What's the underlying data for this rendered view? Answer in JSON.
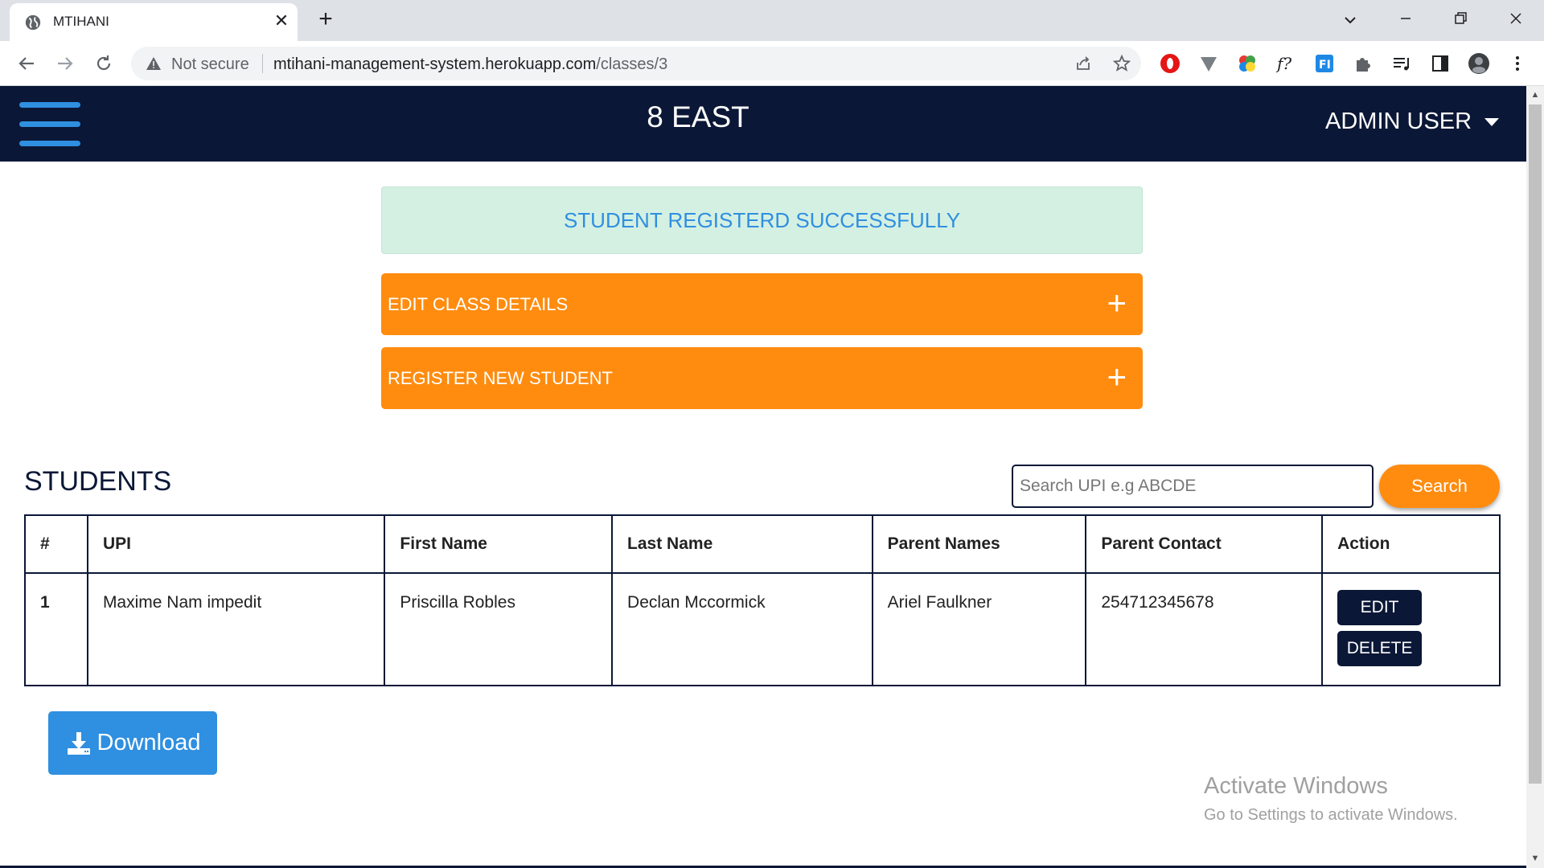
{
  "browser": {
    "tab_title": "MTIHANI",
    "security_label": "Not secure",
    "url_host": "mtihani-management-system.herokuapp.com",
    "url_path": "/classes/3",
    "new_tab_symbol": "+",
    "tab_close_symbol": "✕"
  },
  "header": {
    "title": "8 EAST",
    "user_label": "ADMIN USER"
  },
  "alert": {
    "message": "STUDENT REGISTERD SUCCESSFULLY"
  },
  "accordions": [
    {
      "label": "EDIT CLASS DETAILS",
      "icon": "+"
    },
    {
      "label": "REGISTER NEW STUDENT",
      "icon": "+"
    }
  ],
  "students": {
    "section_title": "STUDENTS",
    "search_placeholder": "Search UPI e.g ABCDE",
    "search_button": "Search",
    "columns": [
      "#",
      "UPI",
      "First Name",
      "Last Name",
      "Parent Names",
      "Parent Contact",
      "Action"
    ],
    "rows": [
      {
        "num": "1",
        "upi": "Maxime Nam impedit",
        "first_name": "Priscilla Robles",
        "last_name": "Declan Mccormick",
        "parent_names": "Ariel Faulkner",
        "parent_contact": "254712345678",
        "edit_label": "EDIT",
        "delete_label": "DELETE"
      }
    ]
  },
  "download": {
    "label": "Download"
  },
  "watermark": {
    "line1": "Activate Windows",
    "line2": "Go to Settings to activate Windows."
  },
  "colors": {
    "navy": "#0b1736",
    "orange": "#ff8c0f",
    "blue": "#2f8fe0",
    "alert_bg": "#d4f0e2"
  }
}
